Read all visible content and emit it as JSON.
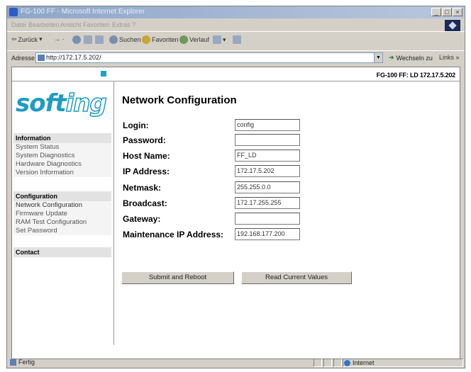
{
  "browser": {
    "title": "FG-100 FF - Microsoft Internet Explorer",
    "menu": [
      "Datei",
      "Bearbeiten",
      "Ansicht",
      "Favoriten",
      "Extras",
      "?"
    ],
    "toolbar": {
      "back": "Zurück",
      "search": "Suchen",
      "favorites": "Favoriten",
      "history": "Verlauf"
    },
    "address_label": "Adresse",
    "address_value": "http://172.17.5.202/",
    "go_label": "Wechseln zu",
    "links_label": "Links",
    "status_text": "Fertig",
    "zone_text": "Internet"
  },
  "header": {
    "device": "FG-100 FF: LD  172.17.5.202"
  },
  "logo": {
    "solid": "soft",
    "outline": "ing"
  },
  "nav": {
    "information": {
      "title": "Information",
      "items": [
        "System Status",
        "System Diagnostics",
        "Hardware Diagnostics",
        "Version Information"
      ]
    },
    "configuration": {
      "title": "Configuration",
      "items": [
        "Network Configuration",
        "Firmware Update",
        "RAM Test Configuration",
        "Set Password"
      ]
    },
    "contact": {
      "title": "Contact"
    }
  },
  "page": {
    "title": "Network Configuration",
    "fields": [
      {
        "label": "Login:",
        "value": "config"
      },
      {
        "label": "Password:",
        "value": ""
      },
      {
        "label": "Host Name:",
        "value": "FF_LD"
      },
      {
        "label": "IP Address:",
        "value": "172.17.5.202"
      },
      {
        "label": "Netmask:",
        "value": "255.255.0.0"
      },
      {
        "label": "Broadcast:",
        "value": "172.17.255.255"
      },
      {
        "label": "Gateway:",
        "value": ""
      },
      {
        "label": "Maintenance IP Address:",
        "value": "192.168.177.200"
      }
    ],
    "submit_label": "Submit and Reboot",
    "read_label": "Read Current Values"
  }
}
